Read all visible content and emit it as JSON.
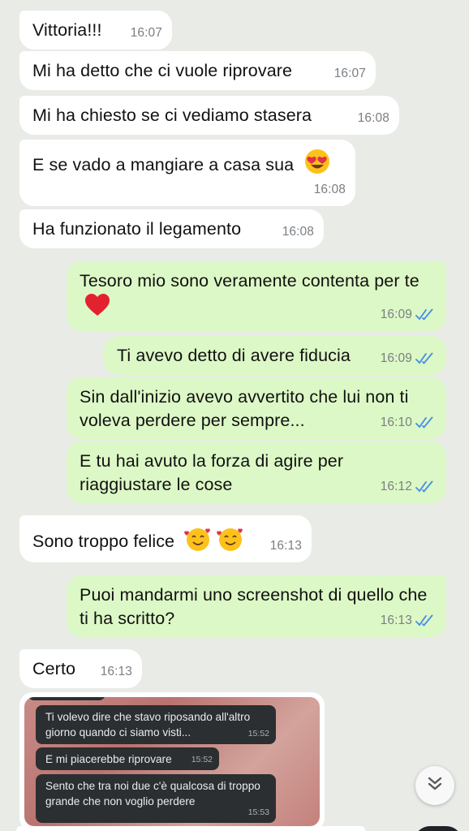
{
  "messages": [
    {
      "dir": "in",
      "text": "Vittoria!!!",
      "time": "16:07"
    },
    {
      "dir": "in",
      "text": "Mi ha detto che ci vuole riprovare",
      "time": "16:07"
    },
    {
      "dir": "in",
      "text": "Mi ha chiesto se ci vediamo stasera",
      "time": "16:08"
    },
    {
      "dir": "in",
      "text": "E se vado a mangiare a casa sua",
      "emoji": "heart-eyes-emoji",
      "time": "16:08"
    },
    {
      "dir": "in",
      "text": "Ha funzionato il legamento",
      "time": "16:08"
    },
    {
      "dir": "out",
      "text": "Tesoro mio sono veramente contenta per te",
      "emoji": "red-heart-emoji",
      "time": "16:09"
    },
    {
      "dir": "out",
      "text": "Ti avevo detto di avere fiducia",
      "time": "16:09"
    },
    {
      "dir": "out",
      "text": "Sin dall'inizio avevo avvertito che lui non ti voleva perdere per sempre...",
      "time": "16:10"
    },
    {
      "dir": "out",
      "text": "E tu hai avuto la forza di agire per riaggiustare le cose",
      "time": "16:12"
    },
    {
      "dir": "in",
      "text": "Sono troppo felice",
      "emoji": "smiling-face-with-hearts-emoji-x2",
      "time": "16:13"
    },
    {
      "dir": "out",
      "text": "Puoi mandarmi uno screenshot di quello che ti ha scritto?",
      "time": "16:13"
    },
    {
      "dir": "in",
      "text": "Certo",
      "time": "16:13"
    }
  ],
  "screenshot_image": {
    "bubbles": [
      {
        "text": "Ti volevo dire che stavo riposando all'altro giorno quando ci siamo visti...",
        "time": "15:52"
      },
      {
        "text": "E mi piacerebbe riprovare",
        "time": "15:52"
      },
      {
        "text": "Sento che tra noi due c'è qualcosa di troppo grande che non voglio perdere",
        "time": "15:53"
      }
    ]
  },
  "colors": {
    "background": "#e8ebe6",
    "incoming": "#ffffff",
    "outgoing": "#dcf8c6",
    "read_check": "#4a90e2"
  },
  "icons": {
    "read_receipt": "double-check-icon",
    "scroll_down": "chevron-double-down-icon"
  }
}
